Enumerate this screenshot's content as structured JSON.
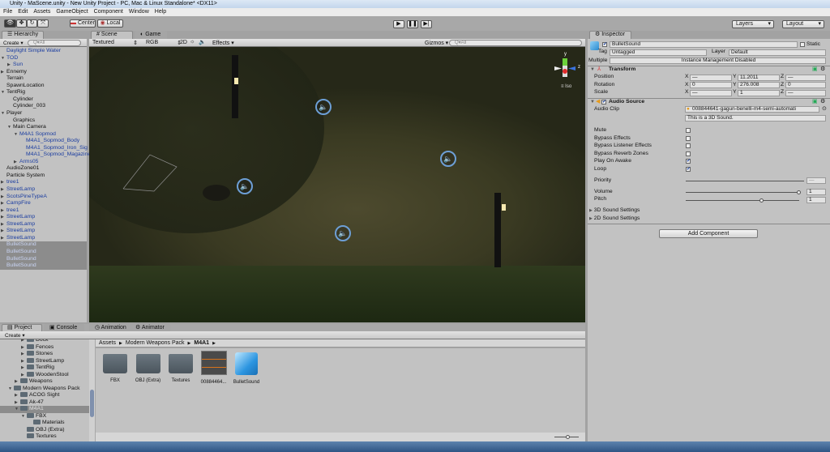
{
  "window": {
    "title": "Unity - MaScene.unity - New Unity Project - PC, Mac & Linux Standalone* <DX11>"
  },
  "menu": [
    "File",
    "Edit",
    "Assets",
    "GameObject",
    "Component",
    "Window",
    "Help"
  ],
  "toolbar": {
    "center": "Center",
    "local": "Local",
    "layers": "Layers",
    "layout": "Layout"
  },
  "hierarchy": {
    "tab": "Hierarchy",
    "create": "Create",
    "search": "Q▾All",
    "items": [
      {
        "label": "Daylight Simple Water",
        "depth": 0,
        "arrow": "",
        "style": "blue"
      },
      {
        "label": "TOD",
        "depth": 0,
        "arrow": "▼",
        "style": "blue"
      },
      {
        "label": "Sun",
        "depth": 1,
        "arrow": "▶",
        "style": "blue"
      },
      {
        "label": "Ennemy",
        "depth": 0,
        "arrow": "▶",
        "style": ""
      },
      {
        "label": "Terrain",
        "depth": 0,
        "arrow": "",
        "style": ""
      },
      {
        "label": "SpawnLocation",
        "depth": 0,
        "arrow": "",
        "style": ""
      },
      {
        "label": "TentRig",
        "depth": 0,
        "arrow": "▼",
        "style": ""
      },
      {
        "label": "Cylinder",
        "depth": 1,
        "arrow": "",
        "style": ""
      },
      {
        "label": "Cylinder_003",
        "depth": 1,
        "arrow": "",
        "style": ""
      },
      {
        "label": "Player",
        "depth": 0,
        "arrow": "▼",
        "style": ""
      },
      {
        "label": "Graphics",
        "depth": 1,
        "arrow": "",
        "style": ""
      },
      {
        "label": "Main Camera",
        "depth": 1,
        "arrow": "▼",
        "style": ""
      },
      {
        "label": "M4A1 Sopmod",
        "depth": 2,
        "arrow": "▼",
        "style": "blue"
      },
      {
        "label": "M4A1_Sopmod_Body",
        "depth": 3,
        "arrow": "",
        "style": "blue"
      },
      {
        "label": "M4A1_Sopmod_Iron_Sig",
        "depth": 3,
        "arrow": "",
        "style": "blue"
      },
      {
        "label": "M4A1_Sopmod_Magazine",
        "depth": 3,
        "arrow": "",
        "style": "blue"
      },
      {
        "label": "Arms05",
        "depth": 2,
        "arrow": "▶",
        "style": "blue"
      },
      {
        "label": "AudioZone01",
        "depth": 0,
        "arrow": "",
        "style": ""
      },
      {
        "label": "Particle System",
        "depth": 0,
        "arrow": "",
        "style": ""
      },
      {
        "label": "tree1",
        "depth": 0,
        "arrow": "▶",
        "style": "blue"
      },
      {
        "label": "StreetLamp",
        "depth": 0,
        "arrow": "▶",
        "style": "blue"
      },
      {
        "label": "ScotsPineTypeA",
        "depth": 0,
        "arrow": "▶",
        "style": "blue"
      },
      {
        "label": "CampFire",
        "depth": 0,
        "arrow": "▶",
        "style": "blue"
      },
      {
        "label": "tree1",
        "depth": 0,
        "arrow": "▶",
        "style": "blue"
      },
      {
        "label": "StreetLamp",
        "depth": 0,
        "arrow": "▶",
        "style": "blue"
      },
      {
        "label": "StreetLamp",
        "depth": 0,
        "arrow": "▶",
        "style": "blue"
      },
      {
        "label": "StreetLamp",
        "depth": 0,
        "arrow": "▶",
        "style": "blue"
      },
      {
        "label": "StreetLamp",
        "depth": 0,
        "arrow": "▶",
        "style": "blue"
      },
      {
        "label": "BulletSound",
        "depth": 0,
        "arrow": "",
        "style": "sel"
      },
      {
        "label": "BulletSound",
        "depth": 0,
        "arrow": "",
        "style": "sel"
      },
      {
        "label": "BulletSound",
        "depth": 0,
        "arrow": "",
        "style": "sel"
      },
      {
        "label": "BulletSound",
        "depth": 0,
        "arrow": "",
        "style": "sel"
      }
    ]
  },
  "scene": {
    "tab_scene": "Scene",
    "tab_game": "Game",
    "shading": "Textured",
    "channel": "RGB",
    "mode2d": "2D",
    "effects": "Effects",
    "gizmos": "Gizmos",
    "search": "Q▾All",
    "persp": "Iso",
    "axis_y": "y",
    "axis_z": "z"
  },
  "inspector": {
    "tab": "Inspector",
    "name": "BulletSound",
    "static": "Static",
    "tag_label": "Tag",
    "tag": "Untagged",
    "layer_label": "Layer",
    "layer": "Default",
    "multiple_label": "Multiple",
    "multiple": "Instance Management Disabled",
    "transform": {
      "title": "Transform",
      "rows": [
        {
          "label": "Position",
          "x": "—",
          "y": "11.2011",
          "z": "—"
        },
        {
          "label": "Rotation",
          "x": "0",
          "y": "276.008",
          "z": "0"
        },
        {
          "label": "Scale",
          "x": "—",
          "y": "1",
          "z": "—"
        }
      ]
    },
    "audio": {
      "title": "Audio Source",
      "clip_label": "Audio Clip",
      "clip": "008844641-gagun-benelli-m4-semi-automati",
      "note": "This is a 3D Sound.",
      "toggles": [
        {
          "label": "Mute",
          "checked": false
        },
        {
          "label": "Bypass Effects",
          "checked": false
        },
        {
          "label": "Bypass Listener Effects",
          "checked": false
        },
        {
          "label": "Bypass Reverb Zones",
          "checked": false
        },
        {
          "label": "Play On Awake",
          "checked": true
        },
        {
          "label": "Loop",
          "checked": true
        }
      ],
      "priority_label": "Priority",
      "priority": "—",
      "volume_label": "Volume",
      "volume": "1",
      "volume_frac": 1.0,
      "pitch_label": "Pitch",
      "pitch": "1",
      "pitch_frac": 0.67,
      "sound3d": "3D Sound Settings",
      "sound2d": "2D Sound Settings"
    },
    "add_component": "Add Component"
  },
  "project": {
    "tabs": [
      "Project",
      "Console",
      "Animation",
      "Animator"
    ],
    "create": "Create",
    "tree": [
      {
        "label": "Dock",
        "depth": 2,
        "arrow": "▶"
      },
      {
        "label": "Fences",
        "depth": 2,
        "arrow": "▶"
      },
      {
        "label": "Stones",
        "depth": 2,
        "arrow": "▶"
      },
      {
        "label": "StreetLamp",
        "depth": 2,
        "arrow": "▶"
      },
      {
        "label": "TentRig",
        "depth": 2,
        "arrow": "▶"
      },
      {
        "label": "WoodenStool",
        "depth": 2,
        "arrow": "▶"
      },
      {
        "label": "Weapons",
        "depth": 1,
        "arrow": "▶"
      },
      {
        "label": "Modern Weapons Pack",
        "depth": 0,
        "arrow": "▼"
      },
      {
        "label": "ACOG Sight",
        "depth": 1,
        "arrow": "▶"
      },
      {
        "label": "Ak-47",
        "depth": 1,
        "arrow": "▶"
      },
      {
        "label": "M4A1",
        "depth": 1,
        "arrow": "▼"
      },
      {
        "label": "FBX",
        "depth": 2,
        "arrow": "▼"
      },
      {
        "label": "Materials",
        "depth": 3,
        "arrow": ""
      },
      {
        "label": "OBJ (Extra)",
        "depth": 2,
        "arrow": ""
      },
      {
        "label": "Textures",
        "depth": 2,
        "arrow": ""
      }
    ],
    "breadcrumb": [
      "Assets",
      "Modern Weapons Pack",
      "M4A1"
    ],
    "assets": [
      {
        "label": "FBX",
        "type": "folder"
      },
      {
        "label": "OBJ (Extra)",
        "type": "folder"
      },
      {
        "label": "Textures",
        "type": "folder"
      },
      {
        "label": "00884464...",
        "type": "audio"
      },
      {
        "label": "BulletSound",
        "type": "prefab"
      }
    ]
  }
}
